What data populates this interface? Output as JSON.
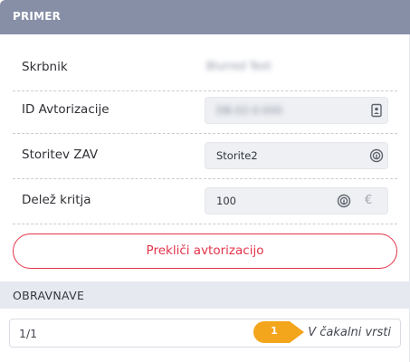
{
  "header": {
    "title": "PRIMER"
  },
  "rows": [
    {
      "label": "Skrbnik",
      "value": "Blurred Text"
    },
    {
      "label": "ID Avtorizacije",
      "value": "DB-02-0-000"
    },
    {
      "label": "Storitev ZAV",
      "value": "Storite2"
    },
    {
      "label": "Delež kritja",
      "value": "100",
      "currency": "€"
    }
  ],
  "actions": {
    "cancel_label": "Prekliči avtorizacijo"
  },
  "obravnave": {
    "title": "OBRAVNAVE",
    "item": {
      "count": "1/1",
      "status": "V čakalni vrsti"
    }
  },
  "marker": {
    "number": "1"
  },
  "colors": {
    "header": "#878fa6",
    "danger": "#e3344a",
    "marker": "#f3a51c"
  }
}
